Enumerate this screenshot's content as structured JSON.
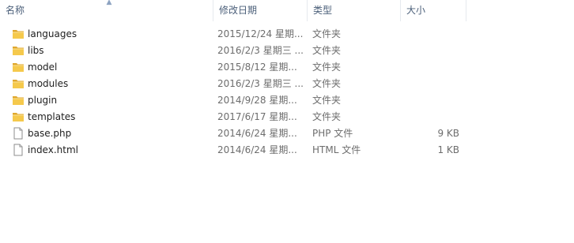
{
  "columns": {
    "name": "名称",
    "date": "修改日期",
    "type": "类型",
    "size": "大小"
  },
  "sort_indicator": "^",
  "files": [
    {
      "name": "languages",
      "date": "2015/12/24 星期...",
      "type": "文件夹",
      "size": "",
      "icon": "folder-icon"
    },
    {
      "name": "libs",
      "date": "2016/2/3 星期三 ...",
      "type": "文件夹",
      "size": "",
      "icon": "folder-icon"
    },
    {
      "name": "model",
      "date": "2015/8/12 星期...",
      "type": "文件夹",
      "size": "",
      "icon": "folder-icon"
    },
    {
      "name": "modules",
      "date": "2016/2/3 星期三 ...",
      "type": "文件夹",
      "size": "",
      "icon": "folder-icon"
    },
    {
      "name": "plugin",
      "date": "2014/9/28 星期...",
      "type": "文件夹",
      "size": "",
      "icon": "folder-icon"
    },
    {
      "name": "templates",
      "date": "2017/6/17 星期...",
      "type": "文件夹",
      "size": "",
      "icon": "folder-icon"
    },
    {
      "name": "base.php",
      "date": "2014/6/24 星期...",
      "type": "PHP 文件",
      "size": "9 KB",
      "icon": "file-icon"
    },
    {
      "name": "index.html",
      "date": "2014/6/24 星期...",
      "type": "HTML 文件",
      "size": "1 KB",
      "icon": "file-icon"
    }
  ],
  "colors": {
    "header_text": "#4c607a",
    "folder_yellow": "#f5c94c",
    "folder_dark": "#e0a82e"
  }
}
